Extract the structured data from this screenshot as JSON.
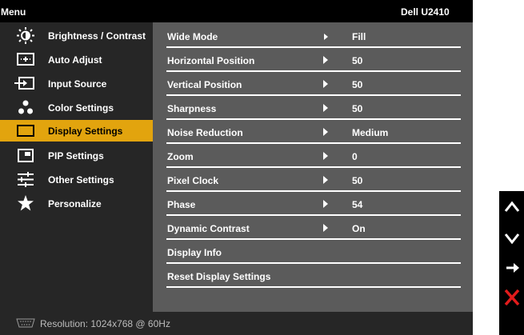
{
  "osd": {
    "title": "Menu",
    "model": "Dell  U2410"
  },
  "sidebar": {
    "items": [
      {
        "label": "Brightness / Contrast",
        "icon": "brightness-icon",
        "active": false
      },
      {
        "label": "Auto Adjust",
        "icon": "auto-adjust-icon",
        "active": false
      },
      {
        "label": "Input Source",
        "icon": "input-source-icon",
        "active": false
      },
      {
        "label": "Color Settings",
        "icon": "color-settings-icon",
        "active": false
      },
      {
        "label": "Display Settings",
        "icon": "display-settings-icon",
        "active": true
      },
      {
        "label": "PIP Settings",
        "icon": "pip-icon",
        "active": false
      },
      {
        "label": "Other Settings",
        "icon": "sliders-icon",
        "active": false
      },
      {
        "label": "Personalize",
        "icon": "star-icon",
        "active": false
      }
    ]
  },
  "panel": {
    "rows": [
      {
        "label": "Wide Mode",
        "value": "Fill",
        "arrow": true
      },
      {
        "label": "Horizontal Position",
        "value": "50",
        "arrow": true
      },
      {
        "label": "Vertical Position",
        "value": "50",
        "arrow": true
      },
      {
        "label": "Sharpness",
        "value": "50",
        "arrow": true
      },
      {
        "label": "Noise Reduction",
        "value": "Medium",
        "arrow": true
      },
      {
        "label": "Zoom",
        "value": "0",
        "arrow": true
      },
      {
        "label": "Pixel Clock",
        "value": "50",
        "arrow": true
      },
      {
        "label": "Phase",
        "value": "54",
        "arrow": true
      },
      {
        "label": "Dynamic Contrast",
        "value": "On",
        "arrow": true
      },
      {
        "label": "Display Info",
        "value": "",
        "arrow": false
      },
      {
        "label": "Reset Display Settings",
        "value": "",
        "arrow": false
      }
    ]
  },
  "status": {
    "input_icon": "vga-icon",
    "resolution": "Resolution: 1024x768 @ 60Hz"
  },
  "buttons": [
    {
      "icon": "up-arrow-icon"
    },
    {
      "icon": "down-arrow-icon"
    },
    {
      "icon": "right-arrow-icon"
    },
    {
      "icon": "close-icon"
    }
  ],
  "colors": {
    "accent": "#e2a40e",
    "close": "#e21b1b"
  }
}
